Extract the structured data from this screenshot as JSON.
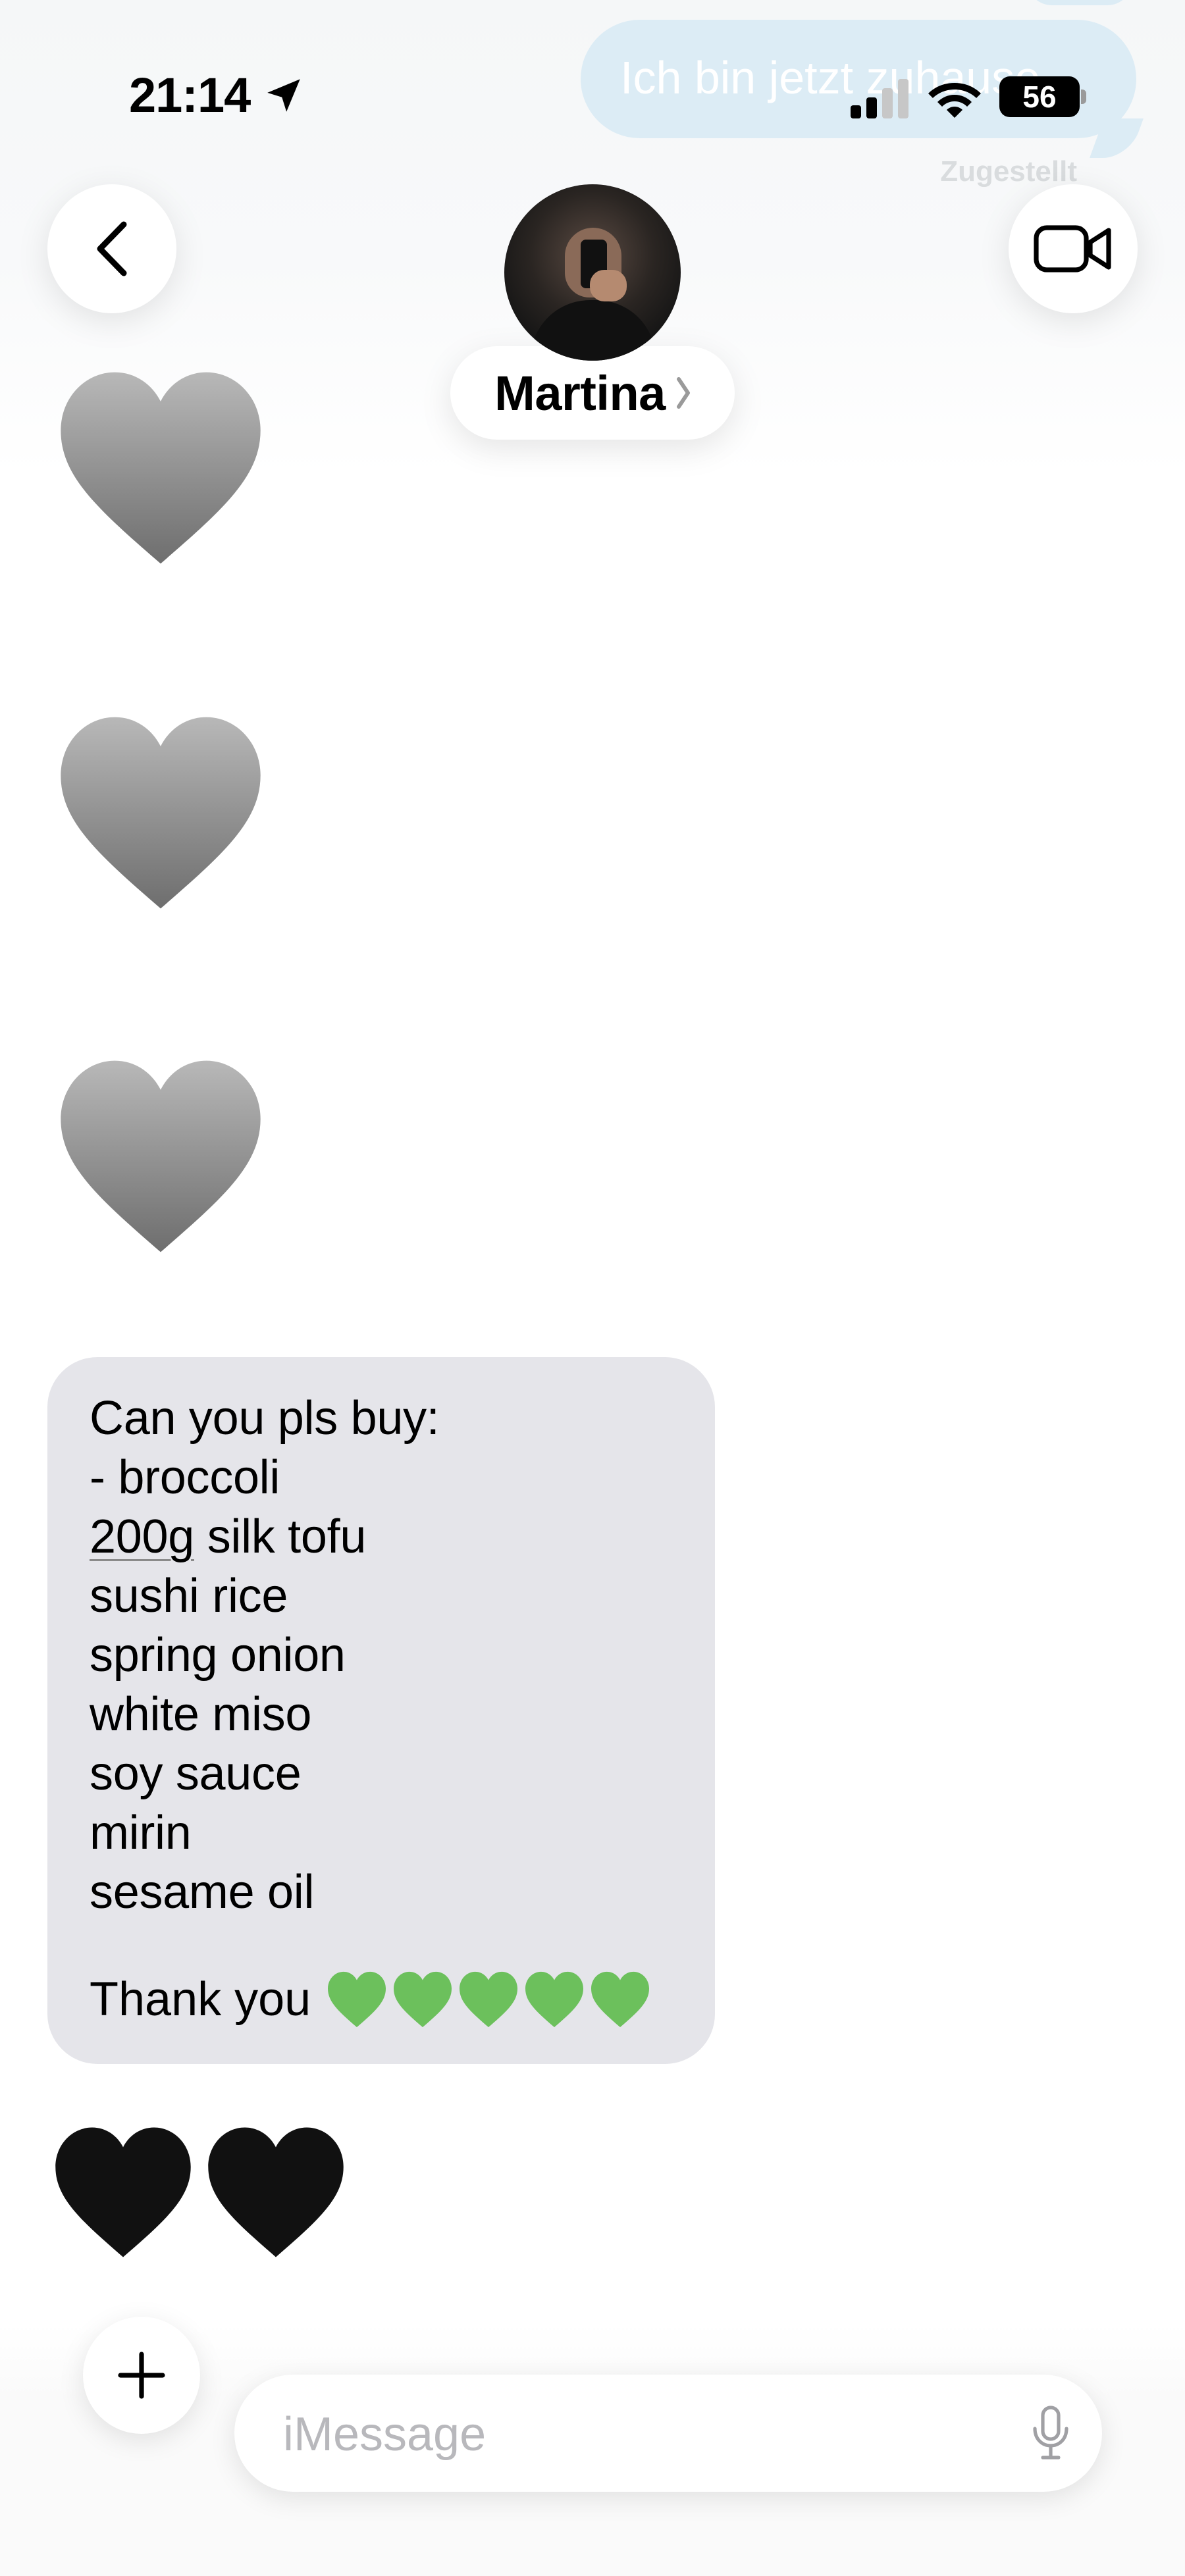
{
  "status_bar": {
    "time": "21:14",
    "battery": "56"
  },
  "header": {
    "contact_name": "Martina"
  },
  "previous_message": {
    "text": "Ich bin jetzt zuhause",
    "status": "Zugestellt"
  },
  "messages": {
    "reaction_hearts": [
      "grey-heart",
      "grey-heart",
      "grey-heart"
    ],
    "list_message": {
      "lines": [
        "Can you pls buy:",
        "- broccoli",
        "200g",
        " silk tofu",
        "sushi rice",
        "spring onion",
        "white miso",
        "soy sauce",
        "mirin",
        "sesame oil"
      ],
      "thanks": "Thank you",
      "emoji": [
        "green-heart",
        "green-heart",
        "green-heart",
        "green-heart",
        "green-heart"
      ]
    },
    "last_reaction": [
      "black-heart",
      "black-heart"
    ]
  },
  "composer": {
    "placeholder": "iMessage"
  },
  "colors": {
    "incoming_bubble": "#e5e5ea",
    "outgoing_bubble": "#dcecf5",
    "grey_heart": "#8e8e8e",
    "green_heart": "#6cc05c",
    "black_heart": "#111111"
  }
}
